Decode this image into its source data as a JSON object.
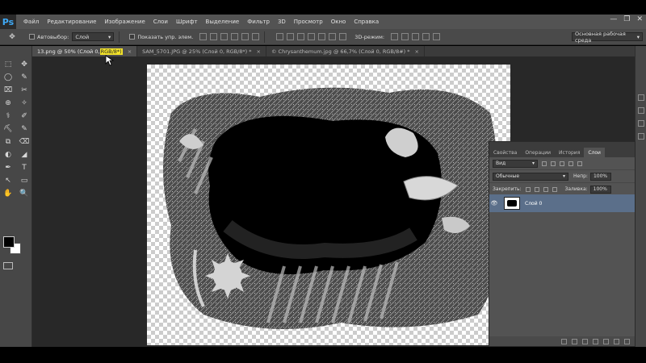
{
  "app": {
    "logo": "Ps"
  },
  "menu": [
    "Файл",
    "Редактирование",
    "Изображение",
    "Слои",
    "Шрифт",
    "Выделение",
    "Фильтр",
    "3D",
    "Просмотр",
    "Окно",
    "Справка"
  ],
  "window_controls": {
    "minimize": "—",
    "restore": "❐",
    "close": "✕"
  },
  "options": {
    "tool_glyph": "✥",
    "auto_select_label": "Автовыбор:",
    "auto_select_value": "Слой",
    "show_controls_label": "Показать упр. элем.",
    "mode_3d_label": "3D-режим:",
    "workspace": "Основная рабочая среда"
  },
  "tabs": [
    {
      "prefix": "13.png @ 50% (Слой 0, ",
      "highlight": "RGB/8*)",
      "close": "×"
    },
    {
      "label": "SAM_5701.JPG @ 25% (Слой 0, RGB/8*) *",
      "close": "×"
    },
    {
      "label": "© Chrysanthemum.jpg @ 66,7% (Слой 0, RGB/8#) *",
      "close": "×"
    }
  ],
  "tools": [
    "⬚",
    "✥",
    "◯",
    "✎",
    "⌧",
    "✂",
    "⊕",
    "✧",
    "⚕",
    "✐",
    "⛏",
    "✎",
    "⧉",
    "⌫",
    "◐",
    "◢",
    "✒",
    "T",
    "↖",
    "▭",
    "✋",
    "🔍"
  ],
  "layers_panel": {
    "tabs": [
      "Свойства",
      "Операции",
      "История",
      "Слои"
    ],
    "filter_label": "Вид",
    "blend_mode": "Обычные",
    "opacity_label": "Непр:",
    "opacity_value": "100%",
    "lock_label": "Закрепить:",
    "fill_label": "Заливка:",
    "fill_value": "100%",
    "layer": {
      "name": "Слой 0",
      "eye": "👁"
    }
  },
  "icons": {
    "collapse": "«",
    "dropdown": "▾"
  }
}
